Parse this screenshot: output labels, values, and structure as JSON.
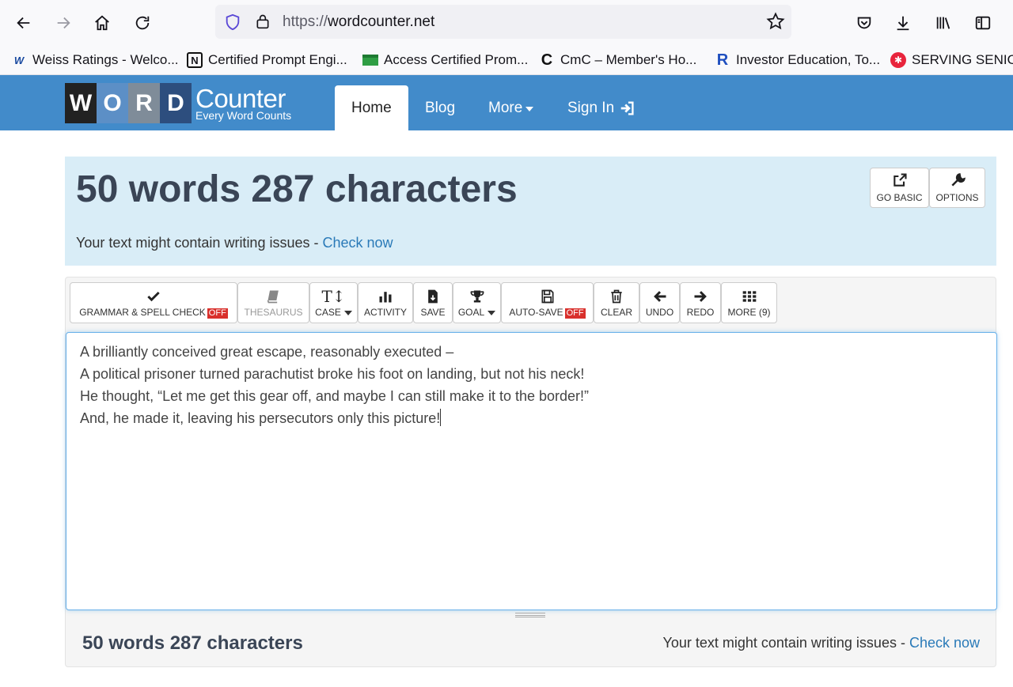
{
  "browser": {
    "url_protocol": "https://",
    "url_domain": "wordcounter.net",
    "bookmarks": [
      {
        "label": "Weiss Ratings - Welco...",
        "icon": "wr-icon"
      },
      {
        "label": "Certified Prompt Engi...",
        "icon": "notion-icon"
      },
      {
        "label": "Access Certified Prom...",
        "icon": "card-icon"
      },
      {
        "label": "CmC – Member's Ho...",
        "icon": "c-icon"
      },
      {
        "label": "Investor Education, To...",
        "icon": "r-icon"
      },
      {
        "label": "SERVING SENIOR",
        "icon": "yelp-icon"
      }
    ]
  },
  "site": {
    "logo_letters": [
      "W",
      "O",
      "R",
      "D"
    ],
    "logo_counter": "Counter",
    "logo_tagline": "Every Word Counts",
    "menu": {
      "home": "Home",
      "blog": "Blog",
      "more": "More",
      "signin": "Sign In"
    }
  },
  "stats": {
    "title": "50 words 287 characters",
    "issue_prefix": "Your text might contain writing issues - ",
    "issue_link": "Check now",
    "go_basic": "GO BASIC",
    "options": "OPTIONS"
  },
  "toolbar": {
    "grammar": "GRAMMAR & SPELL CHECK",
    "grammar_state": "OFF",
    "thesaurus": "THESAURUS",
    "case": "CASE",
    "activity": "ACTIVITY",
    "save": "SAVE",
    "goal": "GOAL",
    "autosave": "AUTO-SAVE",
    "autosave_state": "OFF",
    "clear": "CLEAR",
    "undo": "UNDO",
    "redo": "REDO",
    "more": "MORE (9)"
  },
  "editor": {
    "lines": [
      "A brilliantly conceived great escape, reasonably executed –",
      "A political prisoner turned parachutist broke his foot on landing, but not his neck!",
      "He thought, “Let me get this gear off, and maybe I can still make it to the border!”",
      "And, he made it, leaving his persecutors only this picture!"
    ]
  },
  "bottom": {
    "count": "50 words 287 characters",
    "issue_prefix": "Your text might contain writing issues - ",
    "issue_link": "Check now"
  },
  "colors": {
    "header_blue": "#428bca",
    "panel_blue": "#d9edf7",
    "link_blue": "#2a7ab8",
    "off_red": "#d9302c"
  }
}
